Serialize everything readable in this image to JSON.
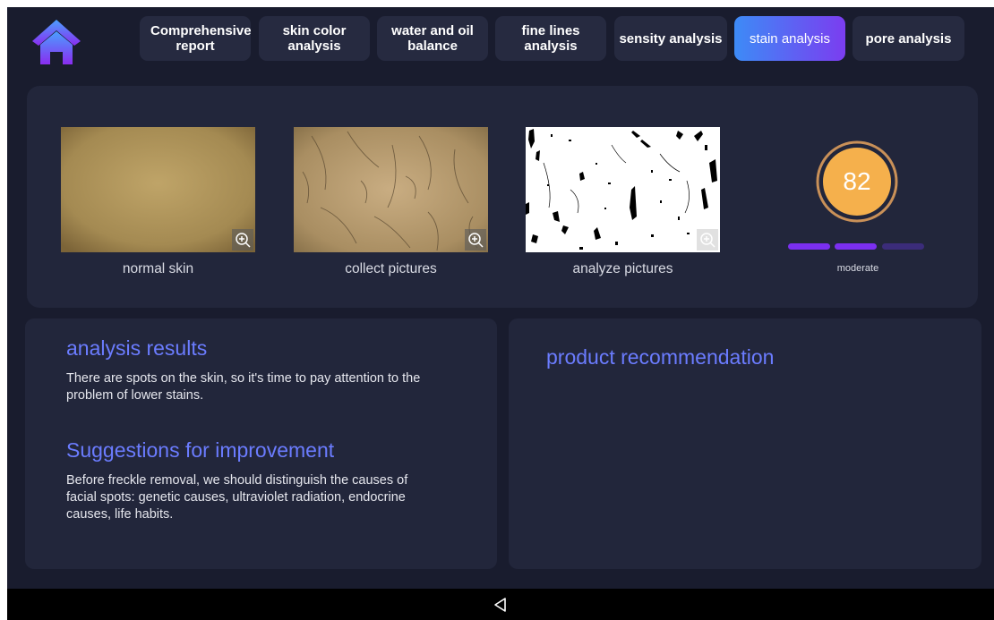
{
  "nav": {
    "home_icon": "home-icon",
    "tabs": [
      {
        "label": "Comprehensive report",
        "active": false
      },
      {
        "label": "skin color analysis",
        "active": false
      },
      {
        "label": "water and oil balance",
        "active": false
      },
      {
        "label": "fine lines analysis",
        "active": false
      },
      {
        "label": "sensity analysis",
        "active": false
      },
      {
        "label": "stain analysis",
        "active": true
      },
      {
        "label": "pore analysis",
        "active": false
      }
    ]
  },
  "images": [
    {
      "label": "normal skin",
      "zoom_icon": "zoom-in-icon"
    },
    {
      "label": "collect pictures",
      "zoom_icon": "zoom-in-icon"
    },
    {
      "label": "analyze pictures",
      "zoom_icon": "zoom-in-icon"
    }
  ],
  "score": {
    "value": "82",
    "level_label": "moderate",
    "level_filled_segments": 2,
    "level_total_segments": 3
  },
  "analysis": {
    "title": "analysis results",
    "text": "There are spots on the skin, so it's time to pay attention to the problem of lower stains."
  },
  "suggestions": {
    "title": "Suggestions for improvement",
    "text": "Before freckle removal, we should distinguish the causes of facial spots: genetic causes, ultraviolet radiation, endocrine causes, life habits."
  },
  "recommendation": {
    "title": "product recommendation"
  },
  "system": {
    "back_icon": "back-triangle-icon"
  },
  "colors": {
    "background": "#191c2e",
    "panel": "#22263b",
    "tab": "#262a40",
    "accent_start": "#3d8bf6",
    "accent_end": "#7b3df0",
    "heading": "#6b7cff",
    "score_fill": "#f5b04c",
    "level_filled": "#7b2ff0",
    "level_empty": "#3b2c7a"
  }
}
